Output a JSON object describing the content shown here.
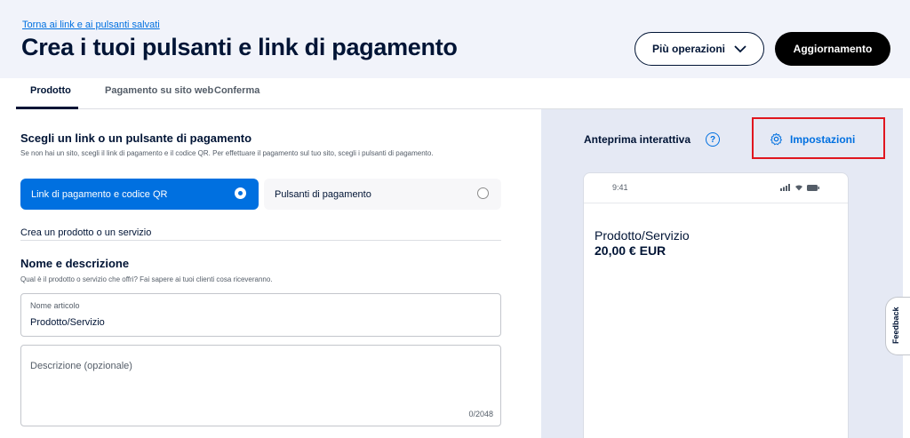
{
  "header": {
    "back_link": "Torna ai link e ai pulsanti salvati",
    "title": "Crea i tuoi pulsanti e link di pagamento",
    "more_ops_label": "Più operazioni",
    "update_label": "Aggiornamento"
  },
  "tabs": [
    {
      "label": "Prodotto",
      "active": true
    },
    {
      "label": "Pagamento su sito web",
      "active": false
    },
    {
      "label": "Conferma",
      "active": false
    }
  ],
  "choose": {
    "heading": "Scegli un link o un pulsante di pagamento",
    "help": "Se non hai un sito, scegli il link di pagamento e il codice QR. Per effettuare il pagamento sul tuo sito, scegli i pulsanti di pagamento.",
    "option_selected": "Link di pagamento e codice QR",
    "option_other": "Pulsanti di pagamento"
  },
  "create_label": "Crea un prodotto o un servizio",
  "name_section": {
    "heading": "Nome e descrizione",
    "help": "Qual è il prodotto o servizio che offri? Fai sapere ai tuoi clienti cosa riceveranno.",
    "item_label": "Nome articolo",
    "item_value": "Prodotto/Servizio",
    "description_placeholder": "Descrizione (opzionale)",
    "description_counter": "0/2048"
  },
  "preview": {
    "title": "Anteprima interattiva",
    "settings_label": "Impostazioni",
    "phone_time": "9:41",
    "product_name": "Prodotto/Servizio",
    "product_price": "20,00 € EUR"
  },
  "feedback_label": "Feedback",
  "colors": {
    "accent": "#0070e0",
    "highlight_border": "#e0161f",
    "text_primary": "#001435",
    "header_bg": "#f1f3fa",
    "preview_bg": "#e5e9f4"
  }
}
